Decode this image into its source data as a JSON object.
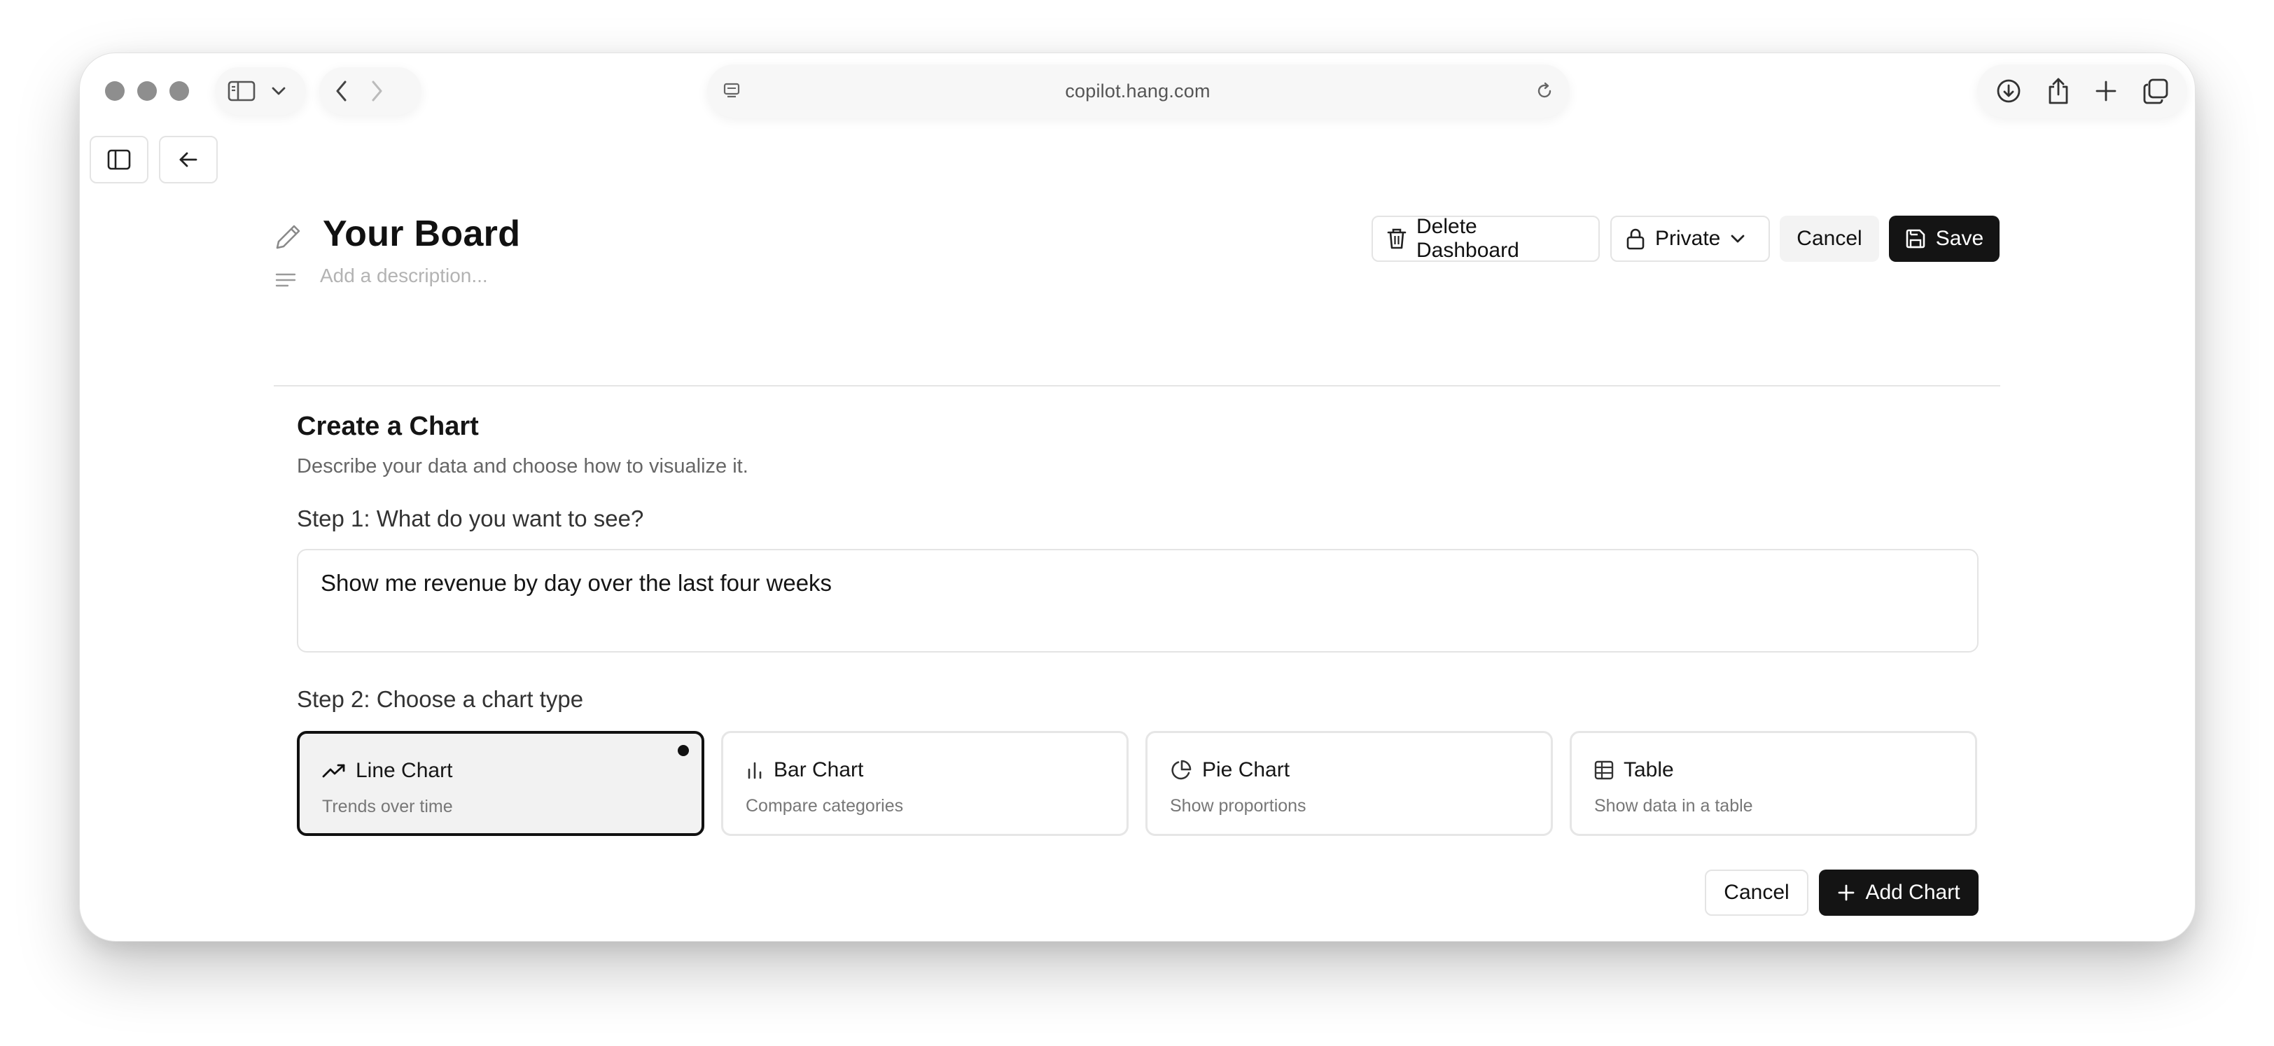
{
  "browser": {
    "url": "copilot.hang.com"
  },
  "board": {
    "title": "Your Board",
    "description_placeholder": "Add a description..."
  },
  "header_actions": {
    "delete_label": "Delete Dashboard",
    "visibility_label": "Private",
    "cancel_label": "Cancel",
    "save_label": "Save"
  },
  "create_chart": {
    "heading": "Create a Chart",
    "subheading": "Describe your data and choose how to visualize it.",
    "step1_label": "Step 1: What do you want to see?",
    "query_value": "Show me revenue by day over the last four weeks",
    "step2_label": "Step 2: Choose a chart type",
    "chart_types": [
      {
        "name": "Line Chart",
        "hint": "Trends over time",
        "icon": "trending-up-icon",
        "selected": true
      },
      {
        "name": "Bar Chart",
        "hint": "Compare categories",
        "icon": "bar-chart-icon",
        "selected": false
      },
      {
        "name": "Pie Chart",
        "hint": "Show proportions",
        "icon": "pie-chart-icon",
        "selected": false
      },
      {
        "name": "Table",
        "hint": "Show data in a table",
        "icon": "table-icon",
        "selected": false
      }
    ],
    "cancel_label": "Cancel",
    "add_label": "Add Chart"
  },
  "colors": {
    "primary_button": "#141414",
    "border": "#e4e4e4",
    "muted_text": "#777777"
  }
}
